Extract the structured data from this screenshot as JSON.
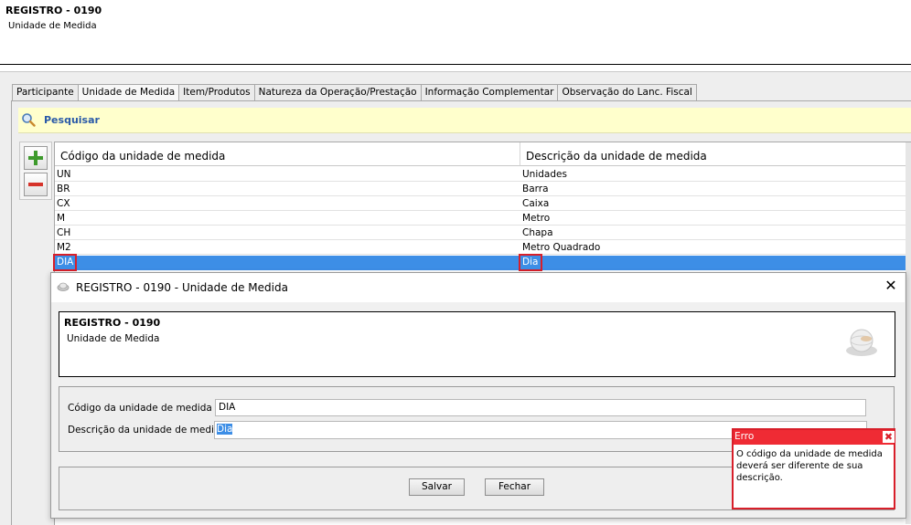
{
  "header": {
    "title": "REGISTRO - 0190",
    "subtitle": "Unidade de Medida"
  },
  "tabs": [
    {
      "label": "Participante"
    },
    {
      "label": "Unidade de Medida",
      "active": true
    },
    {
      "label": "Item/Produtos"
    },
    {
      "label": "Natureza da Operação/Prestação"
    },
    {
      "label": "Informação Complementar"
    },
    {
      "label": "Observação do Lanc. Fiscal"
    }
  ],
  "search": {
    "label": "Pesquisar",
    "icon": "magnifier-icon"
  },
  "toolbar": {
    "add_icon": "plus-icon",
    "remove_icon": "minus-icon"
  },
  "grid": {
    "columns": [
      "Código da unidade de medida",
      "Descrição da unidade de medida"
    ],
    "rows": [
      {
        "code": "UN",
        "desc": "Unidades"
      },
      {
        "code": "BR",
        "desc": "Barra"
      },
      {
        "code": "CX",
        "desc": "Caixa"
      },
      {
        "code": "M",
        "desc": "Metro"
      },
      {
        "code": "CH",
        "desc": "Chapa"
      },
      {
        "code": "M2",
        "desc": "Metro Quadrado"
      },
      {
        "code": "DIA",
        "desc": "Dia",
        "selected": true
      }
    ]
  },
  "dialog": {
    "title": "REGISTRO - 0190 - Unidade de Medida",
    "info_title": "REGISTRO - 0190",
    "info_subtitle": "Unidade de Medida",
    "fields": [
      {
        "label": "Código da unidade de medida",
        "value": "DIA"
      },
      {
        "label": "Descrição da unidade de medida",
        "value": "Dia"
      }
    ],
    "buttons": {
      "save": "Salvar",
      "close": "Fechar"
    }
  },
  "error": {
    "title": "Erro",
    "message": "O código da unidade de medida deverá ser diferente de sua descrição."
  },
  "colors": {
    "selection": "#3d8ee6",
    "error_red": "#ef2b34",
    "highlight_border": "#d81f2a",
    "search_bar": "#ffffcc"
  }
}
